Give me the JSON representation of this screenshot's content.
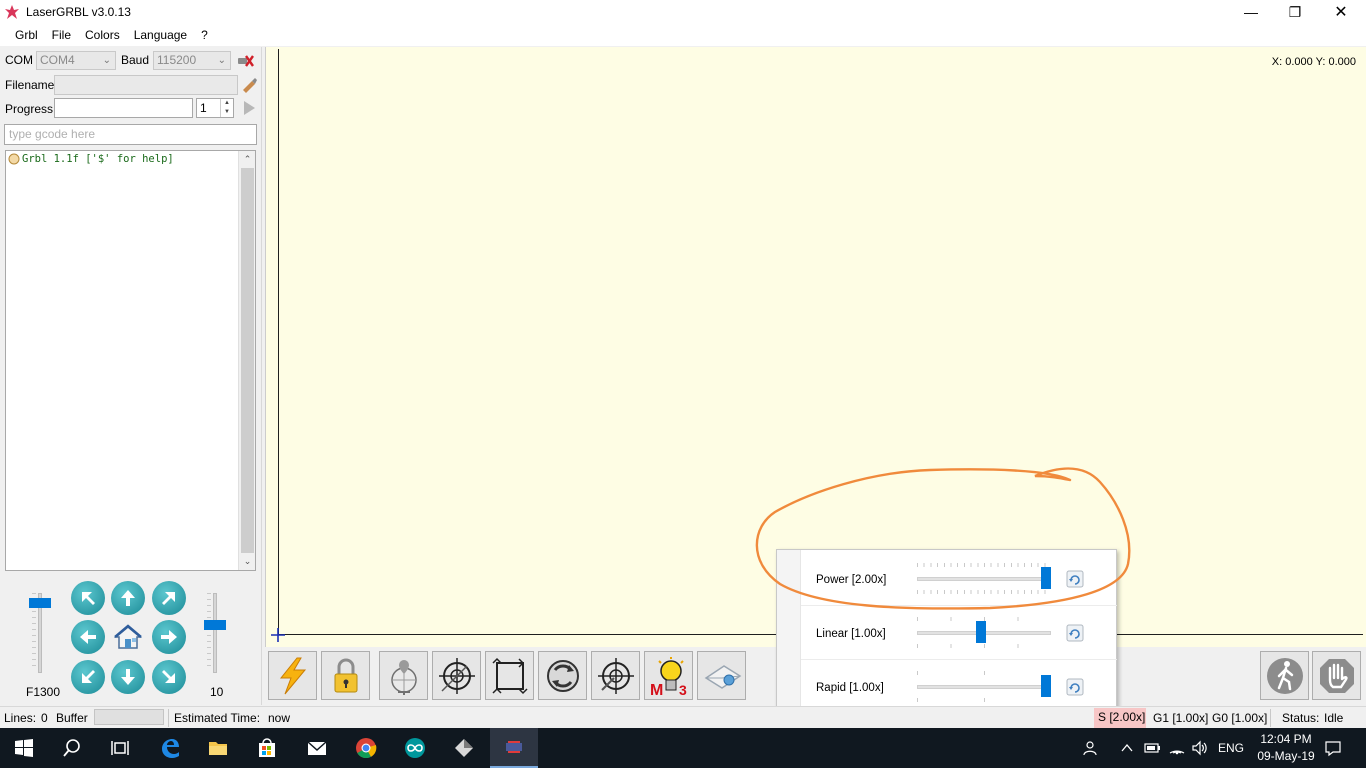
{
  "window": {
    "title": "LaserGRBL v3.0.13"
  },
  "menu": [
    "Grbl",
    "File",
    "Colors",
    "Language",
    "?"
  ],
  "connection": {
    "com_label": "COM",
    "com_value": "COM4",
    "baud_label": "Baud",
    "baud_value": "115200",
    "filename_label": "Filename",
    "filename_value": "",
    "progress_label": "Progress",
    "progress_copies": "1",
    "gcode_placeholder": "type gcode here"
  },
  "console": {
    "lines": [
      "Grbl 1.1f ['$' for help]"
    ]
  },
  "jog": {
    "feed_label": "F1300",
    "step_label": "10",
    "feed_level": 0.93,
    "step_level": 0.62
  },
  "canvas": {
    "coords": "X: 0.000 Y: 0.000"
  },
  "toolbar": [
    "reset-grbl",
    "unlock",
    "goto-origin",
    "set-zero",
    "frame",
    "homing",
    "center-target",
    "user-macro-m3",
    "settings-mail"
  ],
  "overrides": {
    "rows": [
      {
        "label": "Power [2.00x]",
        "value": 2.0,
        "min": 0.1,
        "max": 2.0
      },
      {
        "label": "Linear [1.00x]",
        "value": 1.0,
        "min": 0.1,
        "max": 2.0
      },
      {
        "label": "Rapid [1.00x]",
        "value": 1.0,
        "min": 0.25,
        "max": 1.0
      }
    ]
  },
  "status": {
    "lines_label": "Lines:",
    "lines_value": "0",
    "buffer_label": "Buffer",
    "est_label": "Estimated Time:",
    "est_value": "now",
    "s_override": "S [2.00x]",
    "g1_override": "G1 [1.00x]",
    "g0_override": "G0 [1.00x]",
    "status_label": "Status:",
    "status_value": "Idle"
  },
  "taskbar": {
    "lang": "ENG",
    "time": "12:04 PM",
    "date": "09-May-19"
  },
  "colors": {
    "canvas_bg": "#fefde4",
    "accent": "#0078d7",
    "highlight_pink": "#f7c6c6"
  }
}
